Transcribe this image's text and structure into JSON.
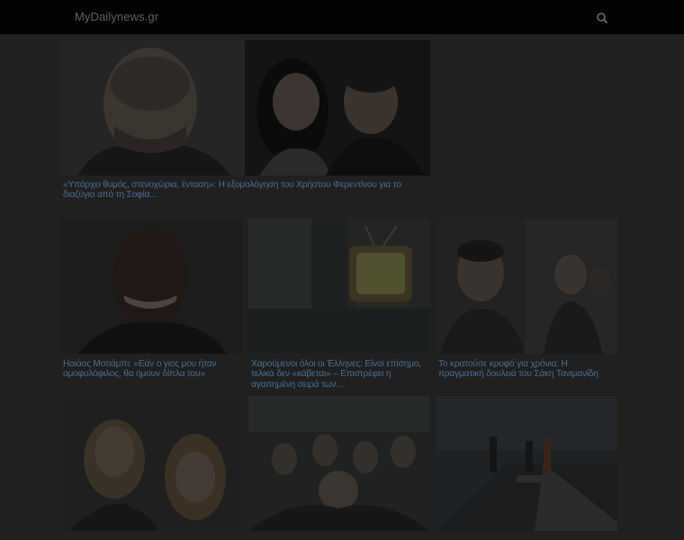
{
  "site": {
    "logo": "MyDailynews.gr"
  },
  "header": {
    "search_icon": "search-icon"
  },
  "articles": [
    {
      "title": "«Υπάρχει θυμός, στενοχώρια, ένταση»: Η εξομολόγηση του Χρήστου Φερεντίνου για το διαζύγιο από τη Σοφία..."
    },
    {
      "title": "Ηαιάος Μοτιάμπι: «Εάν ο γιος μου ήταν ομοφυλόφιλος, θα ήμουν δίπλα του»"
    },
    {
      "title": "Χαρούμενοι όλοι οι Έλληνες: Είναι επίσημο, τελικά δεν «κάβεται» – Επιστρέφει η αγαπημένη σειρά των..."
    },
    {
      "title": "Το κρατούσε κρυφό για χρόνια: Η πραγματική δουλειά του Σάκη Τανιμανίδη"
    },
    {
      "title": ""
    },
    {
      "title": ""
    },
    {
      "title": ""
    }
  ],
  "colors": {
    "page_bg": "#202020",
    "header_bg": "#020202",
    "link": "#4b6f94"
  }
}
